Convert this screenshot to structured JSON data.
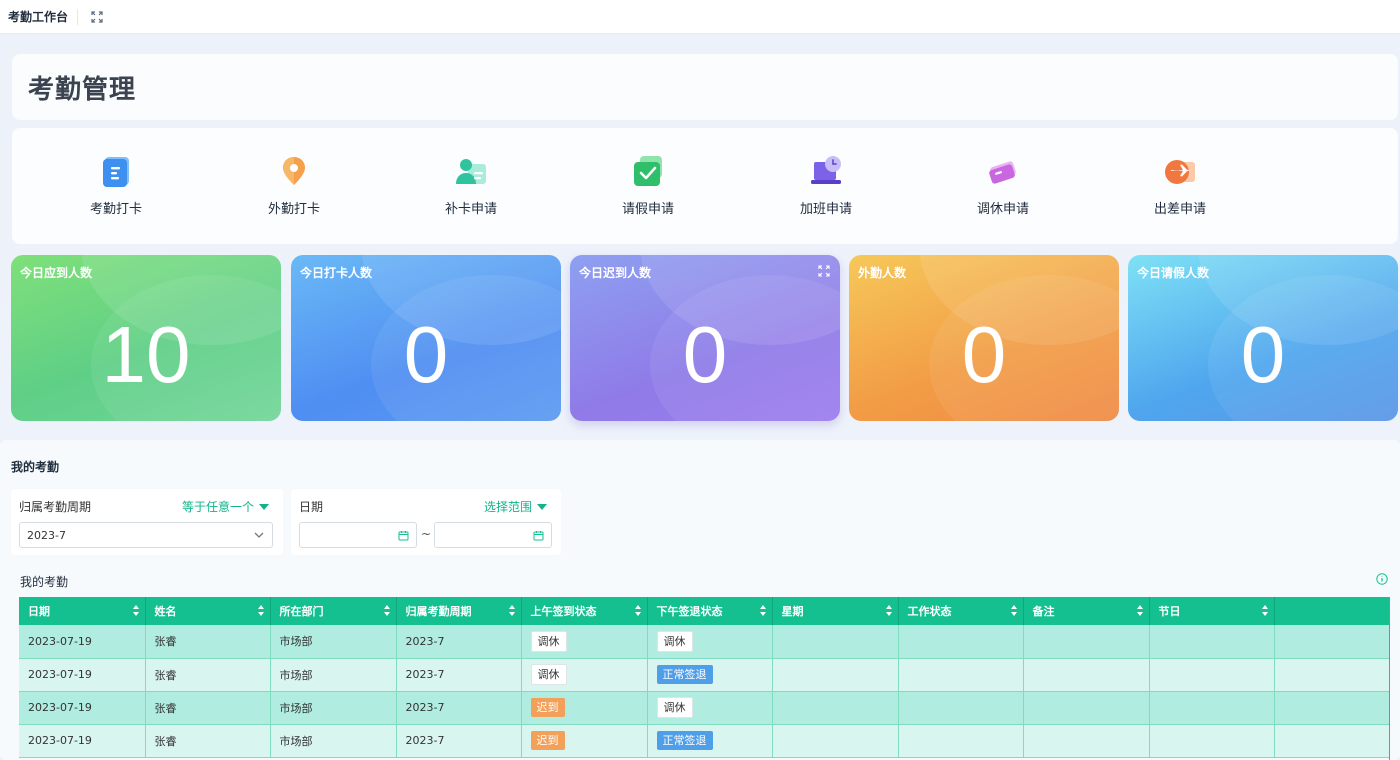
{
  "topbar": {
    "title": "考勤工作台",
    "expand_icon": "expand-icon"
  },
  "header": {
    "title": "考勤管理"
  },
  "actions": [
    {
      "label": "考勤打卡",
      "icon": "clipboard-icon",
      "color": "#3d8ff0"
    },
    {
      "label": "外勤打卡",
      "icon": "location-pin-icon",
      "color": "#f29a3a"
    },
    {
      "label": "补卡申请",
      "icon": "user-card-icon",
      "color": "#2fc3a0"
    },
    {
      "label": "请假申请",
      "icon": "check-shield-icon",
      "color": "#2fbf6a"
    },
    {
      "label": "加班申请",
      "icon": "laptop-clock-icon",
      "color": "#6b52d8"
    },
    {
      "label": "调休申请",
      "icon": "ticket-icon",
      "color": "#c867e0"
    },
    {
      "label": "出差申请",
      "icon": "plane-icon",
      "color": "#f07840"
    }
  ],
  "stats": [
    {
      "label": "今日应到人数",
      "value": "10"
    },
    {
      "label": "今日打卡人数",
      "value": "0"
    },
    {
      "label": "今日迟到人数",
      "value": "0"
    },
    {
      "label": "外勤人数",
      "value": "0"
    },
    {
      "label": "今日请假人数",
      "value": "0"
    }
  ],
  "my_attendance": {
    "title": "我的考勤",
    "filters": {
      "period": {
        "label": "归属考勤周期",
        "operator": "等于任意一个",
        "value": "2023-7"
      },
      "date": {
        "label": "日期",
        "operator": "选择范围",
        "separator": "~"
      }
    },
    "table": {
      "title": "我的考勤",
      "columns": [
        "日期",
        "姓名",
        "所在部门",
        "归属考勤周期",
        "上午签到状态",
        "下午签退状态",
        "星期",
        "工作状态",
        "备注",
        "节日"
      ],
      "rows": [
        {
          "date": "2023-07-19",
          "name": "张睿",
          "dept": "市场部",
          "period": "2023-7",
          "am": {
            "text": "调休",
            "type": "rest"
          },
          "pm": {
            "text": "调休",
            "type": "rest"
          }
        },
        {
          "date": "2023-07-19",
          "name": "张睿",
          "dept": "市场部",
          "period": "2023-7",
          "am": {
            "text": "调休",
            "type": "rest"
          },
          "pm": {
            "text": "正常签退",
            "type": "normal"
          }
        },
        {
          "date": "2023-07-19",
          "name": "张睿",
          "dept": "市场部",
          "period": "2023-7",
          "am": {
            "text": "迟到",
            "type": "late"
          },
          "pm": {
            "text": "调休",
            "type": "rest"
          }
        },
        {
          "date": "2023-07-19",
          "name": "张睿",
          "dept": "市场部",
          "period": "2023-7",
          "am": {
            "text": "迟到",
            "type": "late"
          },
          "pm": {
            "text": "正常签退",
            "type": "normal"
          }
        }
      ]
    }
  },
  "colors": {
    "accent": "#14c08f",
    "late": "#f2a05a",
    "normal": "#4f9ee8"
  }
}
